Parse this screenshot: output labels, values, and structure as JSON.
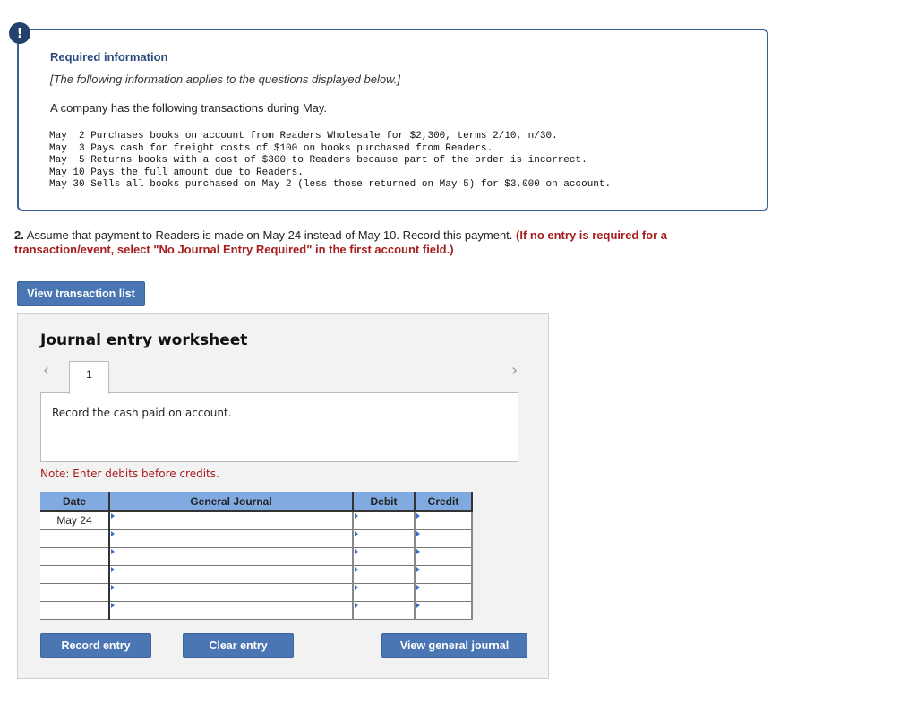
{
  "info": {
    "badge": "!",
    "title": "Required information",
    "subtitle": "[The following information applies to the questions displayed below.]",
    "intro": "A company has the following transactions during May.",
    "transactions": [
      "May  2 Purchases books on account from Readers Wholesale for $2,300, terms 2/10, n/30.",
      "May  3 Pays cash for freight costs of $100 on books purchased from Readers.",
      "May  5 Returns books with a cost of $300 to Readers because part of the order is incorrect.",
      "May 10 Pays the full amount due to Readers.",
      "May 30 Sells all books purchased on May 2 (less those returned on May 5) for $3,000 on account."
    ]
  },
  "question": {
    "number": "2.",
    "text": " Assume that payment to Readers is made on May 24 instead of May 10. Record this payment. ",
    "hint": "(If no entry is required for a transaction/event, select \"No Journal Entry Required\" in the first account field.)"
  },
  "buttons": {
    "view_transactions": "View transaction list",
    "record_entry": "Record entry",
    "clear_entry": "Clear entry",
    "view_general_journal": "View general journal"
  },
  "worksheet": {
    "title": "Journal entry worksheet",
    "prev_icon": "‹",
    "next_icon": "›",
    "tab_label": "1",
    "description": "Record the cash paid on account.",
    "note": "Note: Enter debits before credits.",
    "columns": [
      "Date",
      "General Journal",
      "Debit",
      "Credit"
    ],
    "rows": [
      {
        "date": "May 24",
        "account": "",
        "debit": "",
        "credit": ""
      },
      {
        "date": "",
        "account": "",
        "debit": "",
        "credit": ""
      },
      {
        "date": "",
        "account": "",
        "debit": "",
        "credit": ""
      },
      {
        "date": "",
        "account": "",
        "debit": "",
        "credit": ""
      },
      {
        "date": "",
        "account": "",
        "debit": "",
        "credit": ""
      },
      {
        "date": "",
        "account": "",
        "debit": "",
        "credit": ""
      }
    ]
  }
}
